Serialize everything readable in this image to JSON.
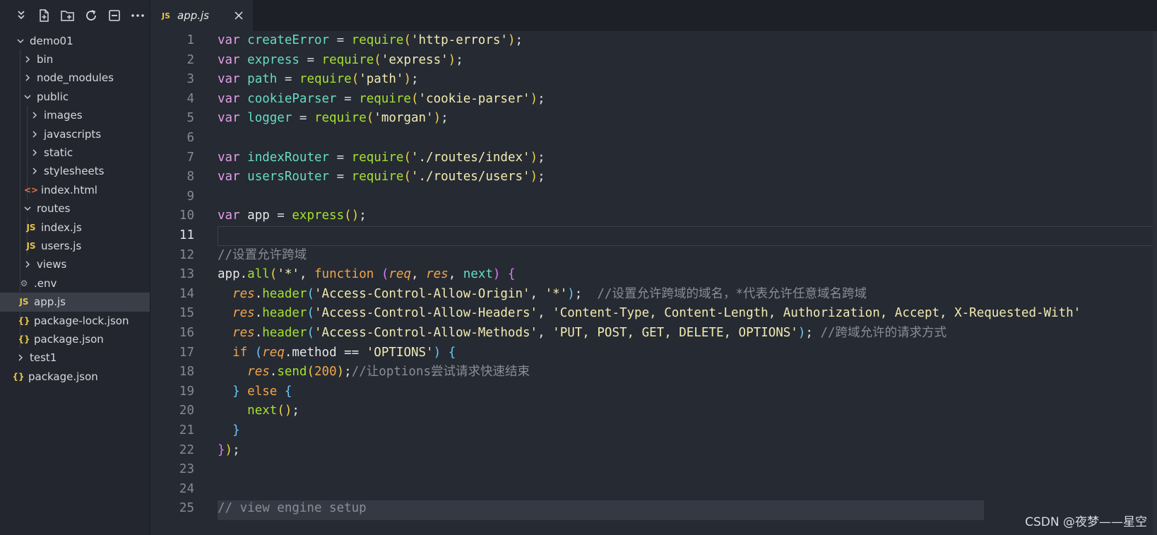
{
  "toolbar": {
    "icons": [
      "collapse-icon",
      "new-file-icon",
      "new-folder-icon",
      "refresh-icon",
      "collapse-all-icon",
      "more-icon"
    ]
  },
  "tree": [
    {
      "label": "demo01",
      "kind": "folder",
      "open": true,
      "depth": 0,
      "chevron": true,
      "selected": false,
      "icon": ""
    },
    {
      "label": "bin",
      "kind": "folder",
      "open": false,
      "depth": 1,
      "chevron": true,
      "selected": false,
      "icon": ""
    },
    {
      "label": "node_modules",
      "kind": "folder",
      "open": false,
      "depth": 1,
      "chevron": true,
      "selected": false,
      "icon": ""
    },
    {
      "label": "public",
      "kind": "folder",
      "open": true,
      "depth": 1,
      "chevron": true,
      "selected": false,
      "icon": ""
    },
    {
      "label": "images",
      "kind": "folder",
      "open": false,
      "depth": 2,
      "chevron": true,
      "selected": false,
      "icon": ""
    },
    {
      "label": "javascripts",
      "kind": "folder",
      "open": false,
      "depth": 2,
      "chevron": true,
      "selected": false,
      "icon": ""
    },
    {
      "label": "static",
      "kind": "folder",
      "open": false,
      "depth": 2,
      "chevron": true,
      "selected": false,
      "icon": ""
    },
    {
      "label": "stylesheets",
      "kind": "folder",
      "open": false,
      "depth": 2,
      "chevron": true,
      "selected": false,
      "icon": ""
    },
    {
      "label": "index.html",
      "kind": "html",
      "depth": 2,
      "chevron": false,
      "selected": false,
      "icon": "<>"
    },
    {
      "label": "routes",
      "kind": "folder",
      "open": true,
      "depth": 1,
      "chevron": true,
      "selected": false,
      "icon": ""
    },
    {
      "label": "index.js",
      "kind": "js",
      "depth": 2,
      "chevron": false,
      "selected": false,
      "icon": "JS"
    },
    {
      "label": "users.js",
      "kind": "js",
      "depth": 2,
      "chevron": false,
      "selected": false,
      "icon": "JS"
    },
    {
      "label": "views",
      "kind": "folder",
      "open": false,
      "depth": 1,
      "chevron": true,
      "selected": false,
      "icon": ""
    },
    {
      "label": ".env",
      "kind": "env",
      "depth": 1,
      "chevron": false,
      "selected": false,
      "icon": "⚙"
    },
    {
      "label": "app.js",
      "kind": "js",
      "depth": 1,
      "chevron": false,
      "selected": true,
      "icon": "JS"
    },
    {
      "label": "package-lock.json",
      "kind": "json",
      "depth": 1,
      "chevron": false,
      "selected": false,
      "icon": "{}"
    },
    {
      "label": "package.json",
      "kind": "json",
      "depth": 1,
      "chevron": false,
      "selected": false,
      "icon": "{}"
    },
    {
      "label": "test1",
      "kind": "folder",
      "open": false,
      "depth": 0,
      "chevron": true,
      "selected": false,
      "icon": ""
    },
    {
      "label": "package.json",
      "kind": "json",
      "depth": 0,
      "chevron": false,
      "selected": false,
      "icon": "{}"
    }
  ],
  "tab": {
    "badge": "JS",
    "name": "app.js",
    "close": "✕"
  },
  "editor": {
    "active_line": 11,
    "lines": [
      [
        [
          "var ",
          "kw"
        ],
        [
          "createError",
          "var"
        ],
        [
          " = ",
          "op"
        ],
        [
          "require",
          "fn"
        ],
        [
          "(",
          "par"
        ],
        [
          "'http-errors'",
          "str"
        ],
        [
          ")",
          "par"
        ],
        [
          ";",
          "plain"
        ]
      ],
      [
        [
          "var ",
          "kw"
        ],
        [
          "express",
          "var"
        ],
        [
          " = ",
          "op"
        ],
        [
          "require",
          "fn"
        ],
        [
          "(",
          "par"
        ],
        [
          "'express'",
          "str"
        ],
        [
          ")",
          "par"
        ],
        [
          ";",
          "plain"
        ]
      ],
      [
        [
          "var ",
          "kw"
        ],
        [
          "path",
          "var"
        ],
        [
          " = ",
          "op"
        ],
        [
          "require",
          "fn"
        ],
        [
          "(",
          "par"
        ],
        [
          "'path'",
          "str"
        ],
        [
          ")",
          "par"
        ],
        [
          ";",
          "plain"
        ]
      ],
      [
        [
          "var ",
          "kw"
        ],
        [
          "cookieParser",
          "var"
        ],
        [
          " = ",
          "op"
        ],
        [
          "require",
          "fn"
        ],
        [
          "(",
          "par"
        ],
        [
          "'cookie-parser'",
          "str"
        ],
        [
          ")",
          "par"
        ],
        [
          ";",
          "plain"
        ]
      ],
      [
        [
          "var ",
          "kw"
        ],
        [
          "logger",
          "var"
        ],
        [
          " = ",
          "op"
        ],
        [
          "require",
          "fn"
        ],
        [
          "(",
          "par"
        ],
        [
          "'morgan'",
          "str"
        ],
        [
          ")",
          "par"
        ],
        [
          ";",
          "plain"
        ]
      ],
      [],
      [
        [
          "var ",
          "kw"
        ],
        [
          "indexRouter",
          "var"
        ],
        [
          " = ",
          "op"
        ],
        [
          "require",
          "fn"
        ],
        [
          "(",
          "par"
        ],
        [
          "'./routes/index'",
          "str"
        ],
        [
          ")",
          "par"
        ],
        [
          ";",
          "plain"
        ]
      ],
      [
        [
          "var ",
          "kw"
        ],
        [
          "usersRouter",
          "var"
        ],
        [
          " = ",
          "op"
        ],
        [
          "require",
          "fn"
        ],
        [
          "(",
          "par"
        ],
        [
          "'./routes/users'",
          "str"
        ],
        [
          ")",
          "par"
        ],
        [
          ";",
          "plain"
        ]
      ],
      [],
      [
        [
          "var ",
          "kw"
        ],
        [
          "app",
          "plain"
        ],
        [
          " = ",
          "op"
        ],
        [
          "express",
          "fn"
        ],
        [
          "(",
          "par"
        ],
        [
          ")",
          "par"
        ],
        [
          ";",
          "plain"
        ]
      ],
      [],
      [
        [
          "//设置允许跨域",
          "cmt"
        ]
      ],
      [
        [
          "app",
          "plain"
        ],
        [
          ".",
          "plain"
        ],
        [
          "all",
          "fn"
        ],
        [
          "(",
          "par"
        ],
        [
          "'*'",
          "str"
        ],
        [
          ", ",
          "plain"
        ],
        [
          "function",
          "amber"
        ],
        [
          " ",
          "plain"
        ],
        [
          "(",
          "par2"
        ],
        [
          "req",
          "param"
        ],
        [
          ", ",
          "plain"
        ],
        [
          "res",
          "param"
        ],
        [
          ", ",
          "plain"
        ],
        [
          "next",
          "var"
        ],
        [
          ")",
          "par2"
        ],
        [
          " ",
          "plain"
        ],
        [
          "{",
          "par2"
        ]
      ],
      [
        [
          "  ",
          "plain"
        ],
        [
          "res",
          "param"
        ],
        [
          ".",
          "plain"
        ],
        [
          "header",
          "fn"
        ],
        [
          "(",
          "par3"
        ],
        [
          "'Access-Control-Allow-Origin'",
          "str"
        ],
        [
          ", ",
          "plain"
        ],
        [
          "'*'",
          "str"
        ],
        [
          ")",
          "par3"
        ],
        [
          ";  ",
          "plain"
        ],
        [
          "//设置允许跨域的域名，*代表允许任意域名跨域",
          "cmt"
        ]
      ],
      [
        [
          "  ",
          "plain"
        ],
        [
          "res",
          "param"
        ],
        [
          ".",
          "plain"
        ],
        [
          "header",
          "fn"
        ],
        [
          "(",
          "par3"
        ],
        [
          "'Access-Control-Allow-Headers'",
          "str"
        ],
        [
          ", ",
          "plain"
        ],
        [
          "'Content-Type, Content-Length, Authorization, Accept, X-Requested-With'",
          "str"
        ]
      ],
      [
        [
          "  ",
          "plain"
        ],
        [
          "res",
          "param"
        ],
        [
          ".",
          "plain"
        ],
        [
          "header",
          "fn"
        ],
        [
          "(",
          "par3"
        ],
        [
          "'Access-Control-Allow-Methods'",
          "str"
        ],
        [
          ", ",
          "plain"
        ],
        [
          "'PUT, POST, GET, DELETE, OPTIONS'",
          "str"
        ],
        [
          ")",
          "par3"
        ],
        [
          "; ",
          "plain"
        ],
        [
          "//跨域允许的请求方式",
          "cmt"
        ]
      ],
      [
        [
          "  ",
          "plain"
        ],
        [
          "if",
          "amber"
        ],
        [
          " ",
          "plain"
        ],
        [
          "(",
          "par3"
        ],
        [
          "req",
          "param"
        ],
        [
          ".method == ",
          "plain"
        ],
        [
          "'OPTIONS'",
          "str"
        ],
        [
          ")",
          "par3"
        ],
        [
          " ",
          "plain"
        ],
        [
          "{",
          "par3"
        ]
      ],
      [
        [
          "    ",
          "plain"
        ],
        [
          "res",
          "param"
        ],
        [
          ".",
          "plain"
        ],
        [
          "send",
          "fn"
        ],
        [
          "(",
          "par"
        ],
        [
          "200",
          "num"
        ],
        [
          ")",
          "par"
        ],
        [
          ";",
          "plain"
        ],
        [
          "//让options尝试请求快速结束",
          "cmt"
        ]
      ],
      [
        [
          "  ",
          "plain"
        ],
        [
          "}",
          "par3"
        ],
        [
          " else ",
          "amber"
        ],
        [
          "{",
          "par3"
        ]
      ],
      [
        [
          "    ",
          "plain"
        ],
        [
          "next",
          "fn"
        ],
        [
          "(",
          "par"
        ],
        [
          ")",
          "par"
        ],
        [
          ";",
          "plain"
        ]
      ],
      [
        [
          "  ",
          "plain"
        ],
        [
          "}",
          "par3"
        ]
      ],
      [
        [
          "}",
          "par2"
        ],
        [
          ")",
          "par"
        ],
        [
          ";",
          "plain"
        ]
      ],
      [],
      [],
      [
        [
          "// view engine setup",
          "cmt"
        ]
      ]
    ]
  },
  "watermark": "CSDN @夜梦——星空",
  "colors": {
    "sidebar_bg": "#23262e",
    "editor_bg": "#262a33",
    "js_badge": "#e6c244",
    "json_badge": "#e6c244",
    "html_badge": "#e8743b"
  }
}
